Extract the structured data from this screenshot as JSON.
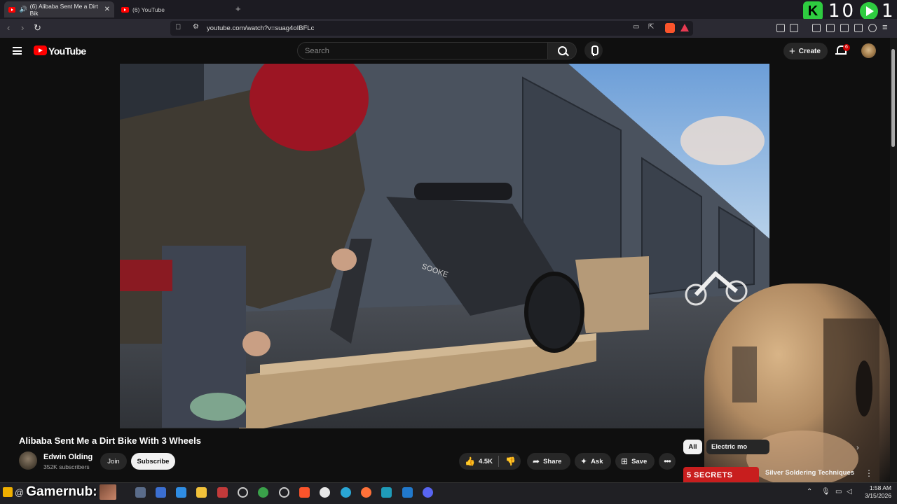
{
  "browser": {
    "tabs": [
      {
        "label": "(6) Alibaba Sent Me a Dirt Bik",
        "active": true
      },
      {
        "label": "(6) YouTube",
        "active": false
      }
    ],
    "url": "youtube.com/watch?v=suag4oIBFLc"
  },
  "overlay": {
    "k_label": "K",
    "count1": "10",
    "count2": "1"
  },
  "youtube": {
    "logo_text": "YouTube",
    "search_placeholder": "Search",
    "create_label": "Create",
    "notif_count": "6"
  },
  "video": {
    "title": "Alibaba Sent Me a Dirt Bike With 3 Wheels",
    "channel_name": "Edwin Olding",
    "subscribers": "352K subscribers",
    "join_label": "Join",
    "subscribe_label": "Subscribe",
    "likes": "4.5K",
    "share_label": "Share",
    "ask_label": "Ask",
    "save_label": "Save",
    "scene_text": "SOOKE"
  },
  "sidebar": {
    "chips": [
      "All",
      "Electric mo"
    ],
    "recommendation": {
      "thumb_text": "5 SECRETS",
      "title": "Silver Soldering Techniques"
    }
  },
  "taskbar": {
    "stream_name": "Gamernub:",
    "time": "1:58 AM",
    "date": "3/15/2026"
  },
  "colors": {
    "yt_red": "#ff0000",
    "background": "#0f0f0f",
    "overlay_green": "#2ecc40",
    "brave_orange": "#fb542b"
  }
}
